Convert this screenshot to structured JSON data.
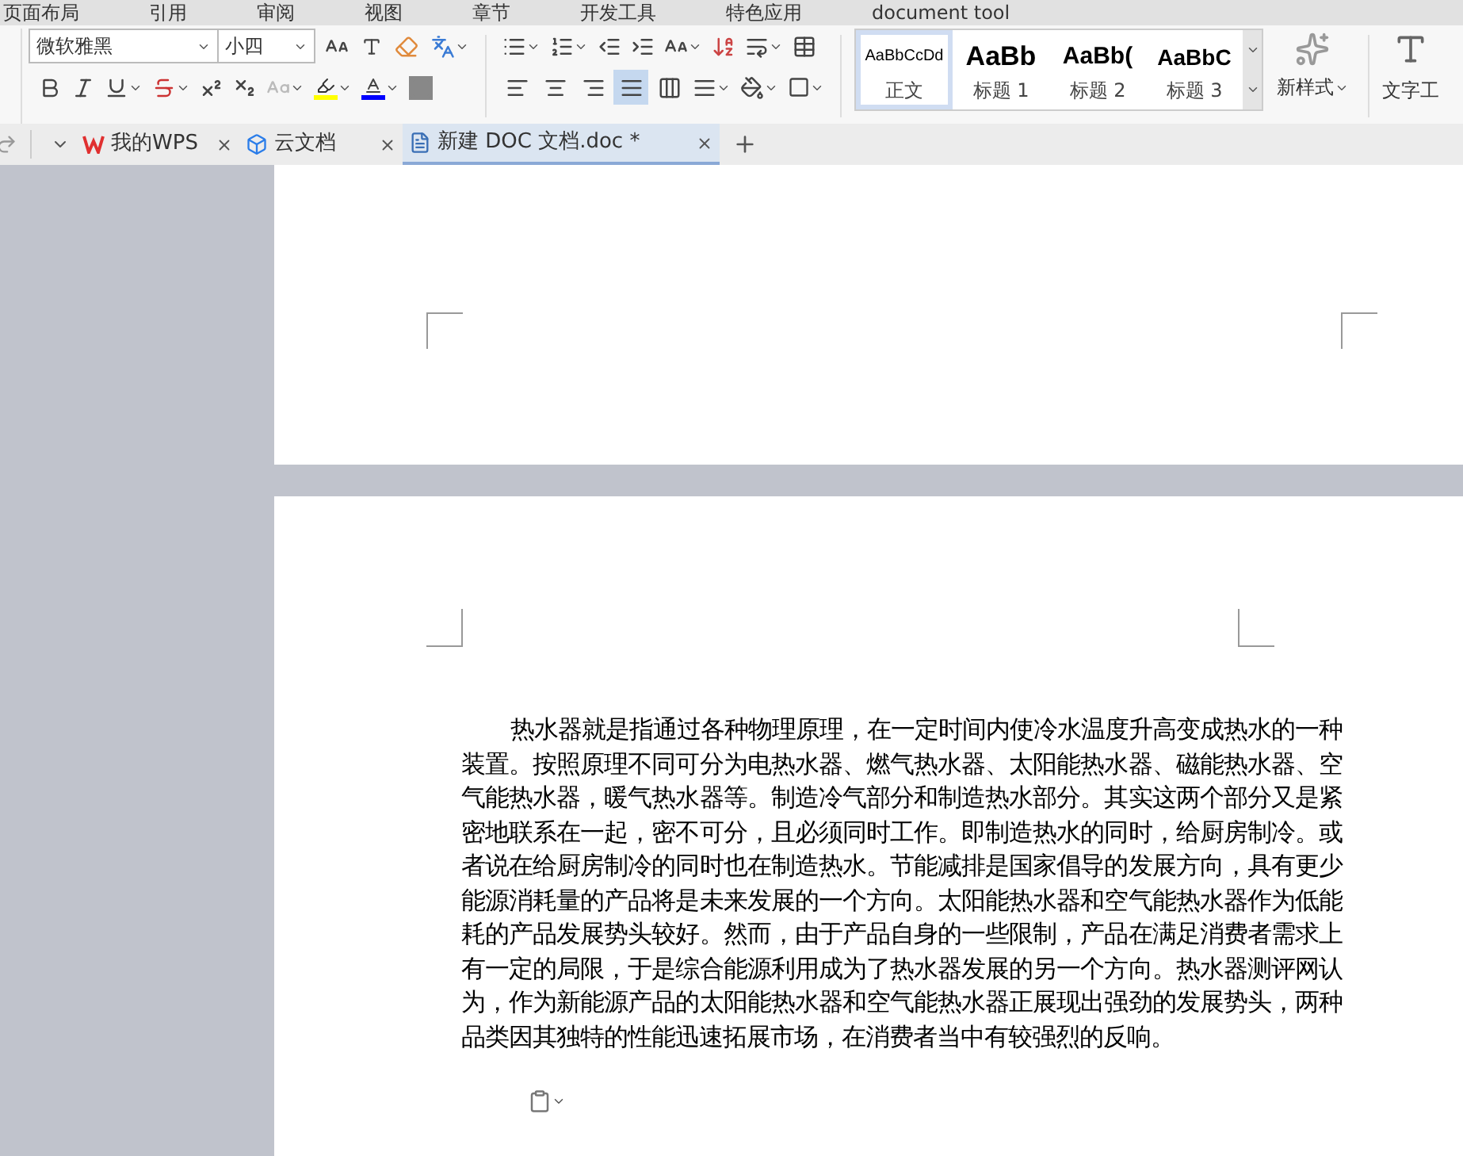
{
  "menu": [
    "页面布局",
    "引用",
    "审阅",
    "视图",
    "章节",
    "开发工具",
    "特色应用",
    "document tool"
  ],
  "toolbar": {
    "font_name": "微软雅黑",
    "font_size": "小四",
    "align_buttons": [
      {
        "kind": "left",
        "selected": false
      },
      {
        "kind": "center",
        "selected": false
      },
      {
        "kind": "right",
        "selected": false
      },
      {
        "kind": "justify",
        "selected": true
      },
      {
        "kind": "distributed",
        "selected": false
      }
    ],
    "styles": [
      {
        "preview": "AaBbCcDd",
        "label": "正文",
        "kind": "normal",
        "selected": true
      },
      {
        "preview": "AaBb",
        "label": "标题 1",
        "kind": "h1",
        "selected": false
      },
      {
        "preview": "AaBb(",
        "label": "标题 2",
        "kind": "h2",
        "selected": false
      },
      {
        "preview": "AaBbC",
        "label": "标题 3",
        "kind": "h3",
        "selected": false
      }
    ],
    "new_style": "新样式",
    "text_tool": "文字工"
  },
  "tabs": [
    {
      "label": "我的WPS",
      "kind": "wps",
      "selected": false
    },
    {
      "label": "云文档",
      "kind": "cloud",
      "selected": false
    },
    {
      "label": "新建 DOC 文档.doc *",
      "kind": "doc",
      "selected": true
    }
  ],
  "document": {
    "paragraph": "热水器就是指通过各种物理原理，在一定时间内使冷水温度升高变成热水的一种装置。按照原理不同可分为电热水器、燃气热水器、太阳能热水器、磁能热水器、空气能热水器，暖气热水器等。制造冷气部分和制造热水部分。其实这两个部分又是紧密地联系在一起，密不可分，且必须同时工作。即制造热水的同时，给厨房制冷。或者说在给厨房制冷的同时也在制造热水。节能减排是国家倡导的发展方向，具有更少能源消耗量的产品将是未来发展的一个方向。太阳能热水器和空气能热水器作为低能耗的产品发展势头较好。然而，由于产品自身的一些限制，产品在满足消费者需求上有一定的局限，于是综合能源利用成为了热水器发展的另一个方向。热水器测评网认为，作为新能源产品的太阳能热水器和空气能热水器正展现出强劲的发展势头，两种品类因其独特的性能迅速拓展市场，在消费者当中有较强烈的反响。"
  }
}
